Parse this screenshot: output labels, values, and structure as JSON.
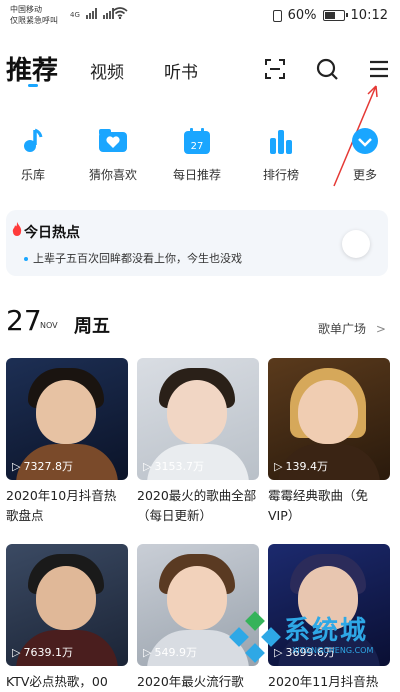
{
  "status_bar": {
    "carrier_line1": "中国移动",
    "carrier_line2": "仅限紧急呼叫",
    "network": "4G",
    "battery": "60%",
    "time": "10:12",
    "battery_level": 0.6
  },
  "nav": {
    "tabs": [
      {
        "label": "推荐"
      },
      {
        "label": "视频"
      },
      {
        "label": "听书"
      }
    ],
    "icons": [
      "scan-icon",
      "search-icon",
      "menu-icon"
    ]
  },
  "quick_entries": [
    {
      "label": "乐库",
      "icon": "music-note-icon"
    },
    {
      "label": "猜你喜欢",
      "icon": "heart-folder-icon"
    },
    {
      "label": "每日推荐",
      "icon": "calendar-icon",
      "icon_text": "27"
    },
    {
      "label": "排行榜",
      "icon": "chart-bars-icon"
    },
    {
      "label": "更多",
      "icon": "chevron-down-circle-icon"
    }
  ],
  "hot": {
    "title": "今日热点",
    "line": "上辈子五百次回眸都没看上你，今生也没戏"
  },
  "date": {
    "day": "27",
    "month": "NOV",
    "weekday": "周五",
    "playlist_link": "歌单广场",
    "chevron": ">"
  },
  "playlists": [
    {
      "plays": "7327.8万",
      "title": "2020年10月抖音热歌盘点"
    },
    {
      "plays": "3153.7万",
      "title": "2020最火的歌曲全部（每日更新）"
    },
    {
      "plays": "139.4万",
      "title": "霉霉经典歌曲（免VIP）"
    },
    {
      "plays": "7639.1万",
      "title": "KTV必点热歌，00"
    },
    {
      "plays": "549.9万",
      "title": "2020年最火流行歌"
    },
    {
      "plays": "3699.6万",
      "title": "2020年11月抖音热"
    }
  ],
  "watermark": {
    "text": "系统城",
    "sub": "XITONGCHENG.COM"
  },
  "colors": {
    "accent": "#1aa6ff",
    "annotation_arrow": "#e53935"
  }
}
